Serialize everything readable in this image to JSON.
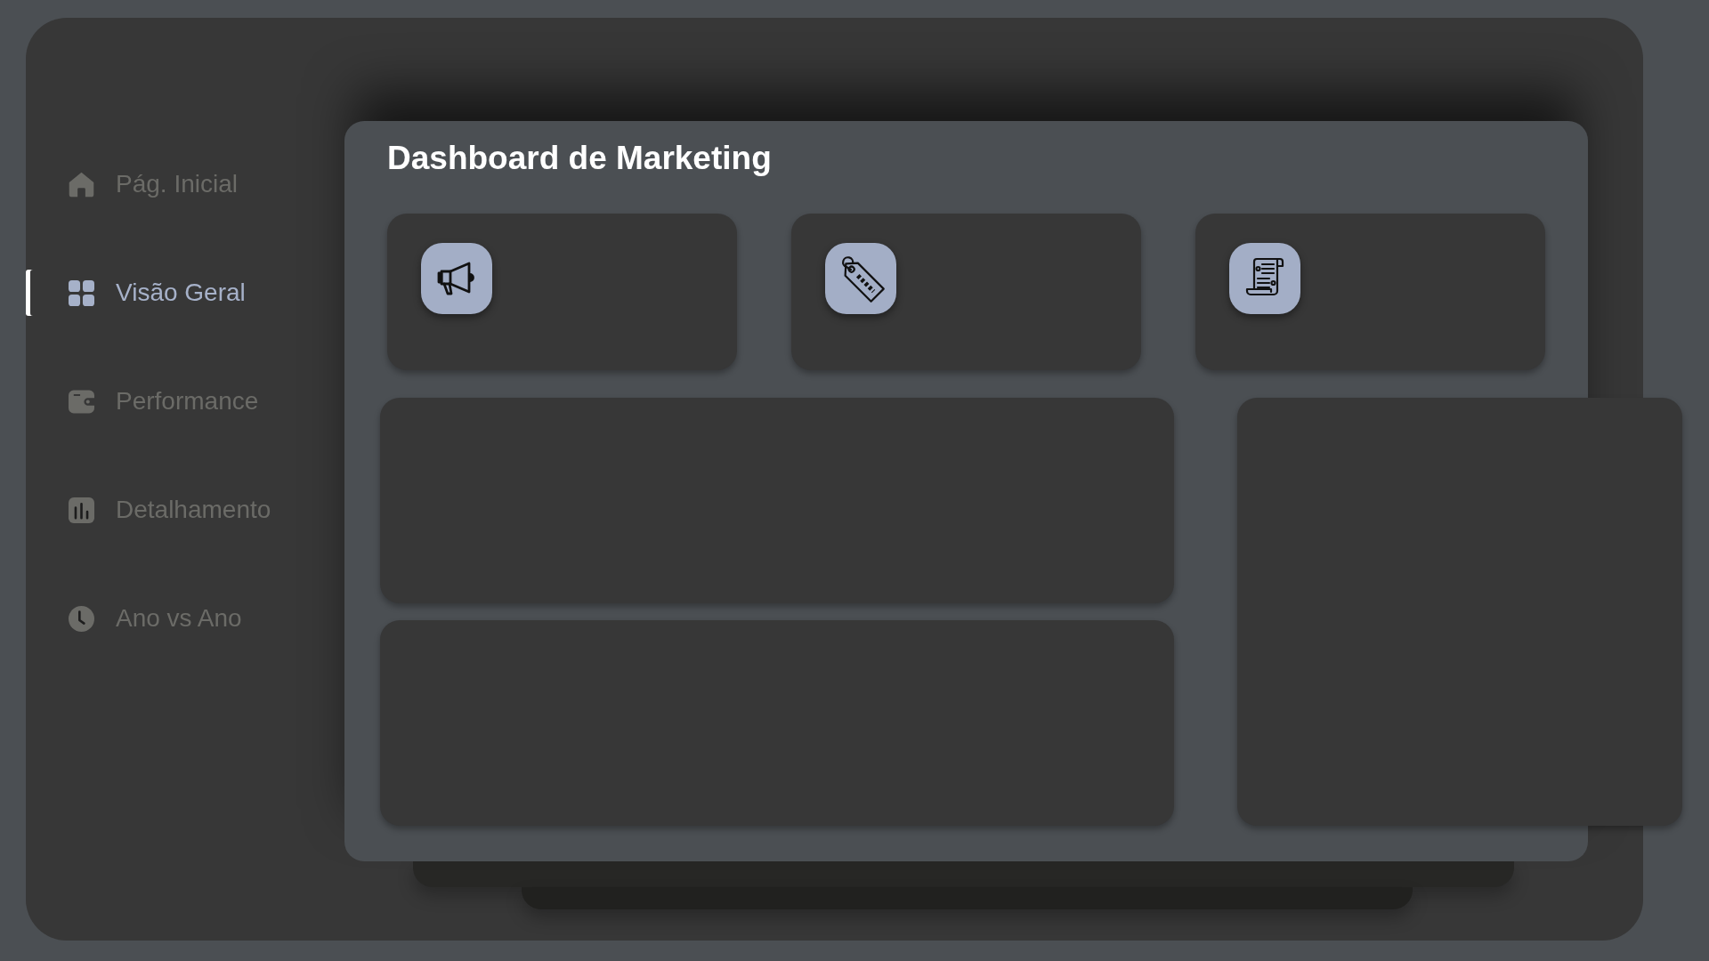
{
  "sidebar": {
    "items": [
      {
        "label": "Pág. Inicial",
        "selected": false
      },
      {
        "label": "Visão Geral",
        "selected": true
      },
      {
        "label": "Performance",
        "selected": false
      },
      {
        "label": "Detalhamento",
        "selected": false
      },
      {
        "label": "Ano vs Ano",
        "selected": false
      }
    ]
  },
  "dashboard": {
    "title": "Dashboard de Marketing"
  }
}
